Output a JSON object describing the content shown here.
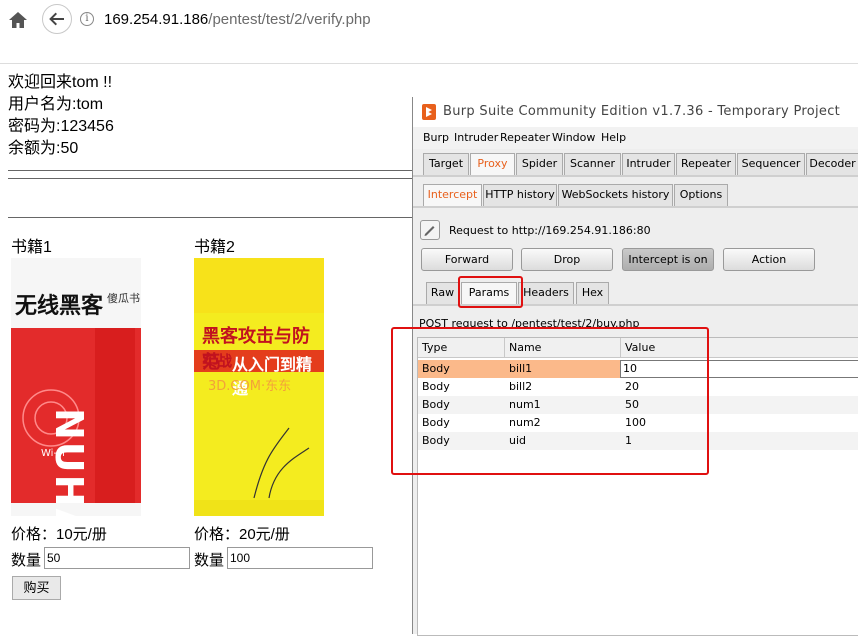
{
  "browser": {
    "url_host": "169.254.91.186",
    "url_path": "/pentest/test/2/verify.php"
  },
  "page": {
    "welcome_lines": [
      "欢迎回来tom !!",
      "用户名为:tom",
      "密码为:123456",
      "余额为:50"
    ],
    "books": [
      {
        "title": "书籍1",
        "price": "价格：10元/册",
        "qty_label": "数量",
        "qty_value": "50",
        "cover": {
          "headline": "无线黑客",
          "sub": "傻瓜书",
          "spine": "NUHACK",
          "wifi": "Wi-Fi"
        }
      },
      {
        "title": "书籍2",
        "price": "价格：20元/册",
        "qty_label": "数量",
        "qty_value": "100",
        "cover": {
          "headline": "黑客攻击与防范",
          "sub": "从入门到精通",
          "tag": "实战",
          "site": "3D.COM·东东"
        }
      }
    ],
    "buy_label": "购买"
  },
  "burp": {
    "title": "Burp Suite Community Edition v1.7.36 - Temporary Project",
    "menu": [
      "Burp",
      "Intruder",
      "Repeater",
      "Window",
      "Help"
    ],
    "main_tabs": [
      "Target",
      "Proxy",
      "Spider",
      "Scanner",
      "Intruder",
      "Repeater",
      "Sequencer",
      "Decoder"
    ],
    "proxy_tabs": [
      "Intercept",
      "HTTP history",
      "WebSockets history",
      "Options"
    ],
    "request_to": "Request to http://169.254.91.186:80",
    "buttons": {
      "forward": "Forward",
      "drop": "Drop",
      "intercept": "Intercept is on",
      "action": "Action"
    },
    "view_tabs": [
      "Raw",
      "Params",
      "Headers",
      "Hex"
    ],
    "post_line": "POST request to /pentest/test/2/buy.php",
    "columns": [
      "Type",
      "Name",
      "Value"
    ],
    "params": [
      {
        "type": "Body",
        "name": "bill1",
        "value": "10"
      },
      {
        "type": "Body",
        "name": "bill2",
        "value": "20"
      },
      {
        "type": "Body",
        "name": "num1",
        "value": "50"
      },
      {
        "type": "Body",
        "name": "num2",
        "value": "100"
      },
      {
        "type": "Body",
        "name": "uid",
        "value": "1"
      }
    ],
    "colors": {
      "accent": "#e8601c",
      "selected_row": "#fbb98a",
      "highlight_box": "#e01010"
    }
  }
}
